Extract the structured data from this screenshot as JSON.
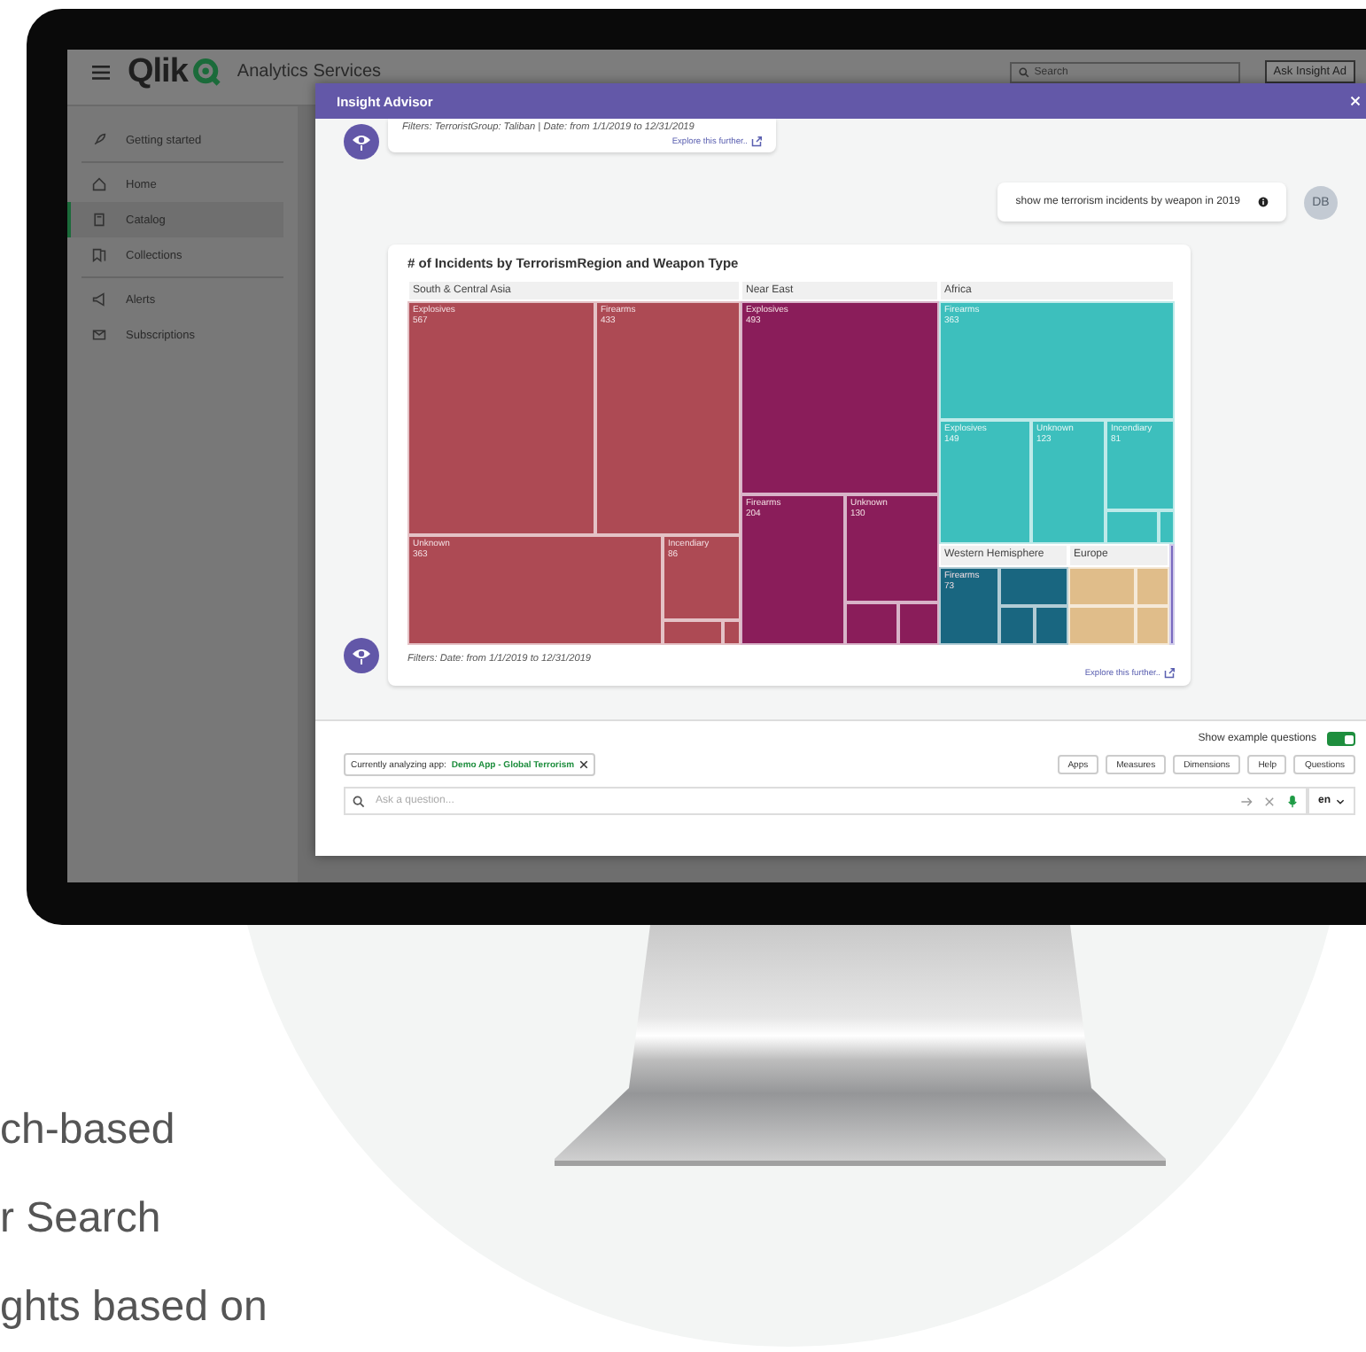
{
  "app": {
    "logo": "Qlik",
    "product": "Analytics Services",
    "search": {
      "placeholder": "Search"
    },
    "ask_button": "Ask Insight Ad",
    "sidebar": {
      "sections": [
        {
          "items": [
            {
              "label": "Getting started",
              "selected": false
            }
          ]
        },
        {
          "items": [
            {
              "label": "Home",
              "selected": false
            },
            {
              "label": "Catalog",
              "selected": true
            },
            {
              "label": "Collections",
              "selected": false
            }
          ]
        },
        {
          "items": [
            {
              "label": "Alerts",
              "selected": false
            },
            {
              "label": "Subscriptions",
              "selected": false
            }
          ]
        }
      ]
    }
  },
  "insight_advisor": {
    "title": "Insight Advisor",
    "messages": [
      {
        "kind": "bot-filter",
        "filters": "Filters: TerroristGroup: Taliban | Date: from 1/1/2019 to 12/31/2019",
        "link": "Explore this further.."
      },
      {
        "kind": "user",
        "text": "show me terrorism incidents by weapon in 2019",
        "avatar": "DB"
      },
      {
        "kind": "bot-chart",
        "title": "# of Incidents by TerrorismRegion and Weapon Type",
        "treemap": {
          "regions": [
            {
              "name": "South & Central Asia",
              "color": "#ad4a54",
              "tiles": [
                {
                  "label": "Explosives",
                  "value": "567"
                },
                {
                  "label": "Firearms",
                  "value": "433"
                },
                {
                  "label": "Unknown",
                  "value": "363"
                },
                {
                  "label": "Incendiary",
                  "value": "86"
                }
              ]
            },
            {
              "name": "Near East",
              "color": "#8a1d5a",
              "tiles": [
                {
                  "label": "Explosives",
                  "value": "493"
                },
                {
                  "label": "Firearms",
                  "value": "204"
                },
                {
                  "label": "Unknown",
                  "value": "130"
                }
              ]
            },
            {
              "name": "Africa",
              "color": "#3dbfbd",
              "tiles": [
                {
                  "label": "Firearms",
                  "value": "363"
                },
                {
                  "label": "Explosives",
                  "value": "149"
                },
                {
                  "label": "Unknown",
                  "value": "123"
                },
                {
                  "label": "Incendiary",
                  "value": "81"
                }
              ]
            },
            {
              "name": "Western Hemisphere",
              "color": "#196680",
              "tiles": [
                {
                  "label": "Firearms",
                  "value": "73"
                }
              ]
            },
            {
              "name": "Europe",
              "color": "#e0bd8a"
            },
            {
              "color": "#7a6ac0"
            }
          ]
        },
        "filters": "Filters: Date: from 1/1/2019 to 12/31/2019",
        "link": "Explore this further.."
      }
    ],
    "show_example_questions": {
      "label": "Show example questions",
      "on": true
    },
    "app_chip": {
      "label": "Currently analyzing app:",
      "app": "Demo App - Global Terrorism"
    },
    "buttons": [
      "Apps",
      "Measures",
      "Dimensions",
      "Help",
      "Questions"
    ],
    "question": {
      "placeholder": "Ask a question..."
    },
    "language": "en"
  },
  "left_text": [
    "ch-based",
    "r Search",
    "ghts based on"
  ]
}
